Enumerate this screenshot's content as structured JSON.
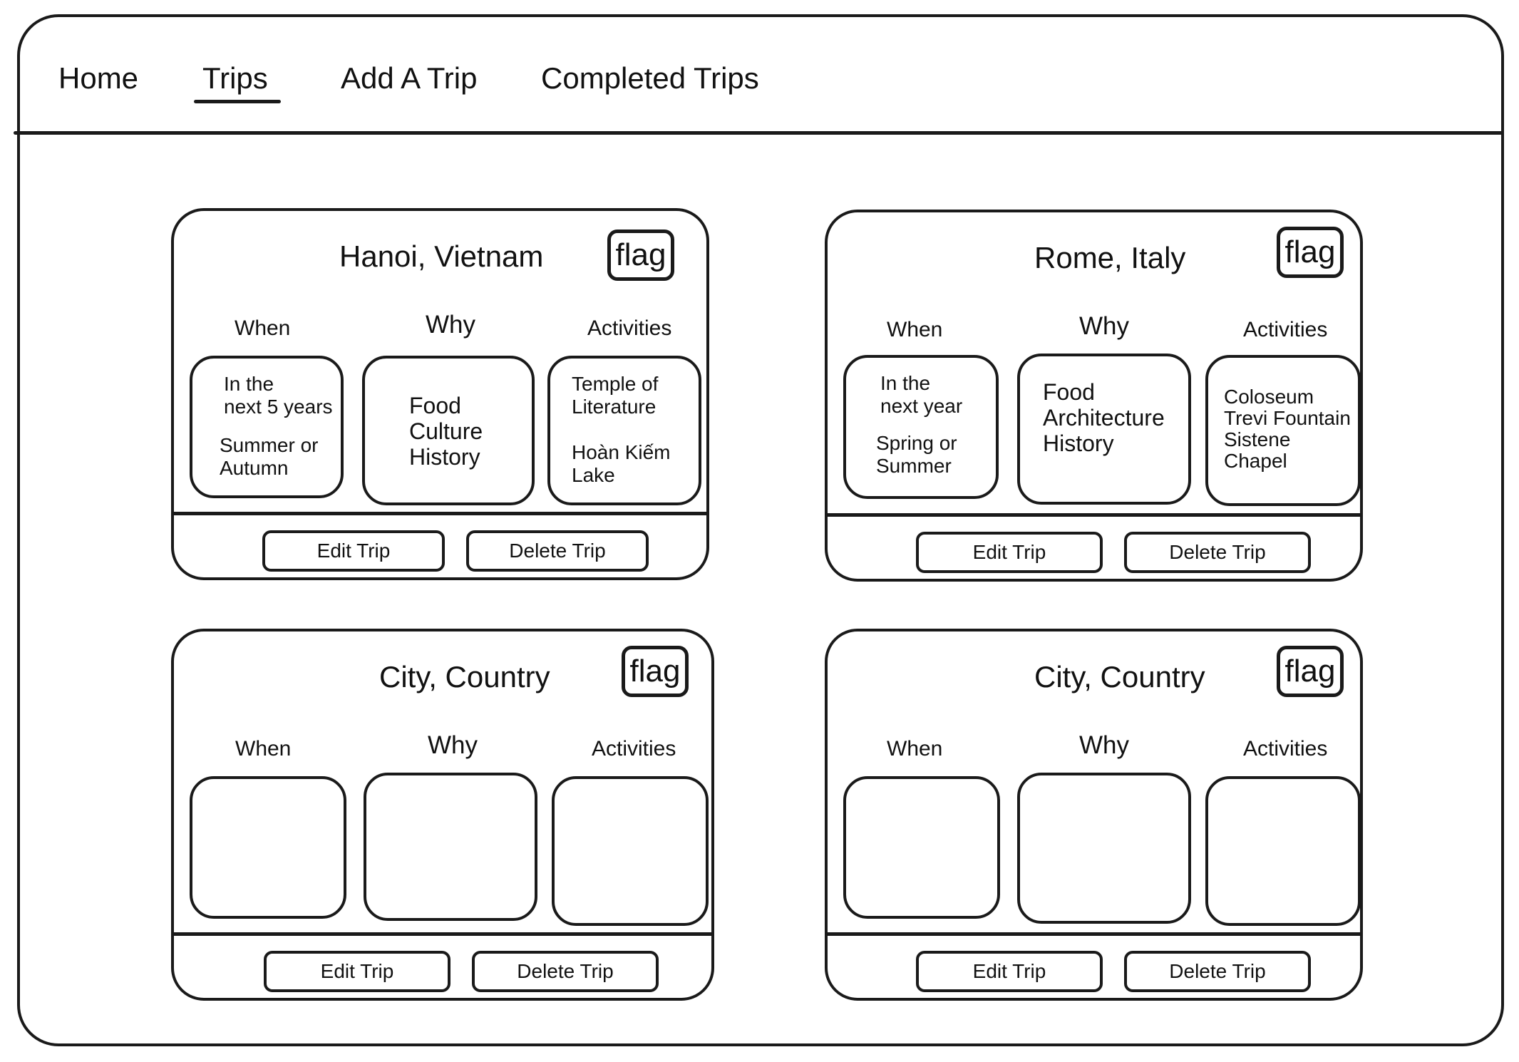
{
  "nav": {
    "items": [
      {
        "label": "Home"
      },
      {
        "label": "Trips"
      },
      {
        "label": "Add A Trip"
      },
      {
        "label": "Completed Trips"
      }
    ],
    "active": "Trips"
  },
  "column_labels": {
    "when": "When",
    "why": "Why",
    "activities": "Activities"
  },
  "trips": [
    {
      "title": "Hanoi, Vietnam",
      "flag": "flag",
      "when_top": "In the\nnext 5 years",
      "when_bottom": "Summer or\nAutumn",
      "why": "Food\nCulture\nHistory",
      "activities_top": "Temple of\nLiterature",
      "activities_bottom": "Hoàn Kiếm\nLake",
      "edit_label": "Edit Trip",
      "delete_label": "Delete Trip"
    },
    {
      "title": "Rome, Italy",
      "flag": "flag",
      "when_top": "In the\nnext year",
      "when_bottom": "Spring or\nSummer",
      "why": "Food\nArchitecture\nHistory",
      "activities_top": "Coloseum\nTrevi Fountain\nSistene Chapel",
      "activities_bottom": "",
      "edit_label": "Edit Trip",
      "delete_label": "Delete Trip"
    },
    {
      "title": "City, Country",
      "flag": "flag",
      "when_top": "",
      "when_bottom": "",
      "why": "",
      "activities_top": "",
      "activities_bottom": "",
      "edit_label": "Edit Trip",
      "delete_label": "Delete Trip"
    },
    {
      "title": "City, Country",
      "flag": "flag",
      "when_top": "",
      "when_bottom": "",
      "why": "",
      "activities_top": "",
      "activities_bottom": "",
      "edit_label": "Edit Trip",
      "delete_label": "Delete Trip"
    }
  ]
}
